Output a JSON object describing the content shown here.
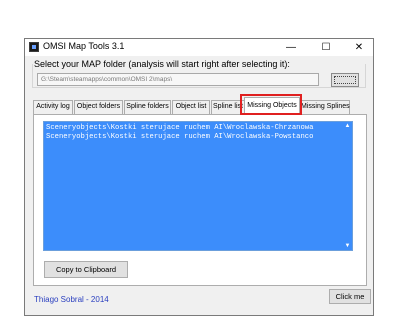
{
  "window": {
    "title": "OMSI Map Tools 3.1",
    "controls": {
      "minimize": "—",
      "maximize": "☐",
      "close": "✕"
    }
  },
  "folder": {
    "group_label": "Select your MAP folder (analysis will start right after selecting it):",
    "path_value": "G:\\Steam\\steamapps\\common\\OMSI 2\\maps\\"
  },
  "tabs": [
    {
      "label": "Activity log"
    },
    {
      "label": "Object folders"
    },
    {
      "label": "Spline folders"
    },
    {
      "label": "Object list"
    },
    {
      "label": "Spline list"
    },
    {
      "label": "Missing Objects"
    },
    {
      "label": "Missing Splines"
    }
  ],
  "active_tab": "Missing Objects",
  "list": {
    "items": [
      "Sceneryobjects\\Kostki sterujace ruchem AI\\Wroclawska-Chrzanowa",
      "Sceneryobjects\\Kostki sterujace ruchem AI\\Wroclawska-Powstanco"
    ]
  },
  "buttons": {
    "copy": "Copy to Clipboard",
    "click_me": "Click me"
  },
  "footer": {
    "credit": "Thiago Sobral - 2014"
  },
  "colors": {
    "list_background": "#3c8dfb",
    "highlight_border": "#e02020",
    "credit_text": "#2a3fbf"
  }
}
